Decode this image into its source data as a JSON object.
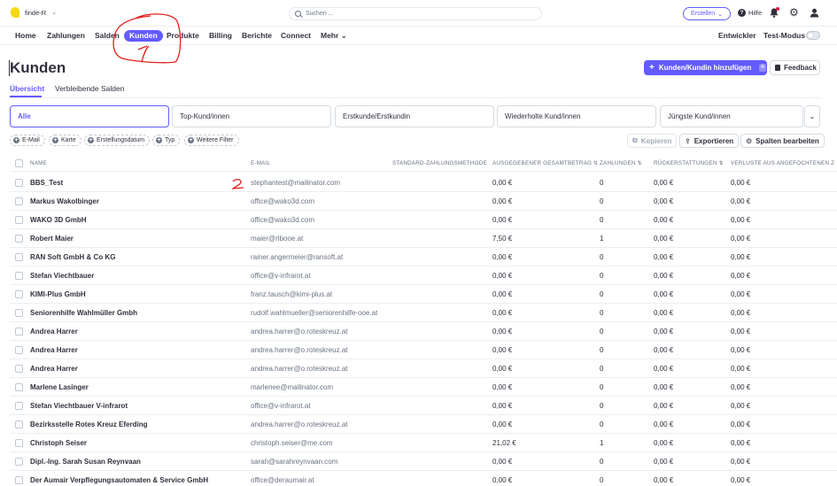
{
  "topbar": {
    "account_name": "finde-R",
    "search_placeholder": "Suchen ...",
    "create_label": "Erstellen",
    "help_label": "Hilfe"
  },
  "nav": {
    "items": [
      "Home",
      "Zahlungen",
      "Salden",
      "Kunden",
      "Produkte",
      "Billing",
      "Berichte",
      "Connect",
      "Mehr"
    ],
    "active": "Kunden",
    "developer_label": "Entwickler",
    "testmode_label": "Test-Modus"
  },
  "page": {
    "title": "Kunden",
    "add_button": "Kunden/Kundin hinzufügen",
    "add_badge": "n",
    "feedback_button": "Feedback",
    "tabs": [
      "Übersicht",
      "Verbleibende Salden"
    ]
  },
  "segments": [
    "Alle",
    "Top-Kund/innen",
    "Erstkunde/Erstkundin",
    "Wiederholte Kund/innen",
    "Jüngste Kund/innen"
  ],
  "filters": [
    "E-Mail",
    "Karte",
    "Erstellungsdatum",
    "Typ",
    "Weitere Filter"
  ],
  "actions": {
    "copy": "Kopieren",
    "export": "Exportieren",
    "edit_columns": "Spalten bearbeiten"
  },
  "table": {
    "headers": [
      "NAME",
      "E-MAIL",
      "STANDARD-ZAHLUNGSMETHODE",
      "AUSGEGEBENER GESAMTBETRAG",
      "ZAHLUNGEN",
      "RÜCKERSTATTUNGEN",
      "VERLUSTE AUS ANGEFOCHTENEN Z"
    ],
    "rows": [
      {
        "name": "BBS_Test",
        "email": "stephantest@mailinator.com",
        "total": "0,00 €",
        "payments": "0",
        "refunds": "0,00 €",
        "losses": "0,00 €"
      },
      {
        "name": "Markus Wakolbinger",
        "email": "office@wako3d.com",
        "total": "0,00 €",
        "payments": "0",
        "refunds": "0,00 €",
        "losses": "0,00 €"
      },
      {
        "name": "WAKO 3D GmbH",
        "email": "office@wako3d.com",
        "total": "0,00 €",
        "payments": "0",
        "refunds": "0,00 €",
        "losses": "0,00 €"
      },
      {
        "name": "Robert Maier",
        "email": "maier@rlbooe.at",
        "total": "7,50 €",
        "payments": "1",
        "refunds": "0,00 €",
        "losses": "0,00 €"
      },
      {
        "name": "RAN Soft GmbH & Co KG",
        "email": "rainer.angermeier@ransoft.at",
        "total": "0,00 €",
        "payments": "0",
        "refunds": "0,00 €",
        "losses": "0,00 €"
      },
      {
        "name": "Stefan Viechtbauer",
        "email": "office@v-infrarot.at",
        "total": "0,00 €",
        "payments": "0",
        "refunds": "0,00 €",
        "losses": "0,00 €"
      },
      {
        "name": "KIMI-Plus GmbH",
        "email": "franz.tausch@kimi-plus.at",
        "total": "0,00 €",
        "payments": "0",
        "refunds": "0,00 €",
        "losses": "0,00 €"
      },
      {
        "name": "Seniorenhilfe Wahlmüller Gmbh",
        "email": "rudolf.wahlmueller@seniorenhilfe-ooe.at",
        "total": "0,00 €",
        "payments": "0",
        "refunds": "0,00 €",
        "losses": "0,00 €"
      },
      {
        "name": "Andrea Harrer",
        "email": "andrea.harrer@o.roteskreuz.at",
        "total": "0,00 €",
        "payments": "0",
        "refunds": "0,00 €",
        "losses": "0,00 €"
      },
      {
        "name": "Andrea Harrer",
        "email": "andrea.harrer@o.roteskreuz.at",
        "total": "0,00 €",
        "payments": "0",
        "refunds": "0,00 €",
        "losses": "0,00 €"
      },
      {
        "name": "Andrea Harrer",
        "email": "andrea.harrer@o.roteskreuz.at",
        "total": "0,00 €",
        "payments": "0",
        "refunds": "0,00 €",
        "losses": "0,00 €"
      },
      {
        "name": "Marlene Lasinger",
        "email": "marlenee@mailinator.com",
        "total": "0,00 €",
        "payments": "0",
        "refunds": "0,00 €",
        "losses": "0,00 €"
      },
      {
        "name": "Stefan Viechtbauer V-infrarot",
        "email": "office@v-infrarot.at",
        "total": "0,00 €",
        "payments": "0",
        "refunds": "0,00 €",
        "losses": "0,00 €"
      },
      {
        "name": "Bezirksstelle Rotes Kreuz Eferding",
        "email": "andrea.harrer@o.roteskreuz.at",
        "total": "0,00 €",
        "payments": "0",
        "refunds": "0,00 €",
        "losses": "0,00 €"
      },
      {
        "name": "Christoph Seiser",
        "email": "christoph.seiser@me.com",
        "total": "21,02 €",
        "payments": "1",
        "refunds": "0,00 €",
        "losses": "0,00 €"
      },
      {
        "name": "Dipl.-Ing. Sarah Susan Reynvaan",
        "email": "sarah@sarahreynvaan.com",
        "total": "0,00 €",
        "payments": "0",
        "refunds": "0,00 €",
        "losses": "0,00 €"
      },
      {
        "name": "Der Aumair Verpflegungsautomaten & Service GmbH",
        "email": "office@deraumair.at",
        "total": "0,00 €",
        "payments": "0",
        "refunds": "0,00 €",
        "losses": "0,00 €"
      }
    ]
  },
  "colors": {
    "accent": "#635bff",
    "annotation": "#e0201b"
  },
  "icons": [
    "logo-icon",
    "chevron-down-icon",
    "search-icon",
    "help-icon",
    "bell-icon",
    "gear-icon",
    "user-icon",
    "plus-icon",
    "copy-icon",
    "export-icon",
    "settings-icon"
  ]
}
